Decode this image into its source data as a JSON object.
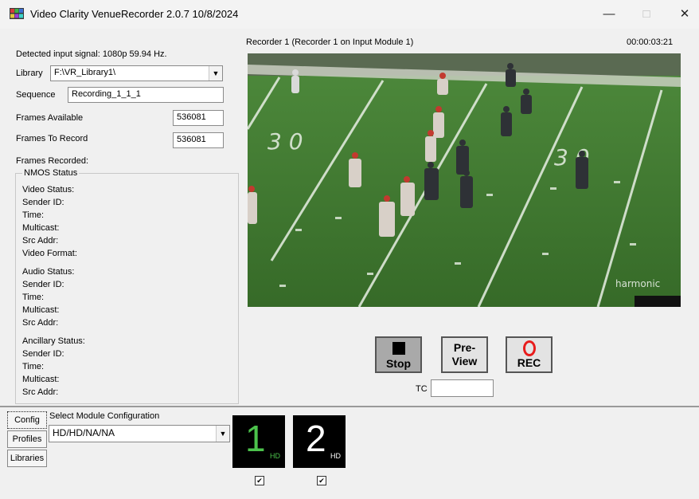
{
  "window": {
    "title": "Video Clarity VenueRecorder  2.0.7  10/8/2024",
    "minimize_glyph": "—",
    "maximize_glyph": "□",
    "close_glyph": "✕"
  },
  "left_panel": {
    "detected_signal": "Detected input signal: 1080p 59.94 Hz.",
    "library_label": "Library",
    "library_value": "F:\\VR_Library1\\",
    "sequence_label": "Sequence",
    "sequence_value": "Recording_1_1_1",
    "frames_available_label": "Frames Available",
    "frames_available_value": "536081",
    "frames_to_record_label": "Frames To Record",
    "frames_to_record_value": "536081",
    "frames_recorded_label": "Frames Recorded:"
  },
  "nmos": {
    "title": "NMOS Status",
    "video_lines": [
      "Video Status:",
      "Sender ID:",
      "Time:",
      "Multicast:",
      "Src Addr:",
      "Video Format:"
    ],
    "audio_lines": [
      "Audio Status:",
      "Sender ID:",
      "Time:",
      "Multicast:",
      "Src Addr:"
    ],
    "ancillary_lines": [
      "Ancillary Status:",
      "Sender ID:",
      "Time:",
      "Multicast:",
      "Src Addr:"
    ]
  },
  "preview": {
    "recorder_label": "Recorder 1 (Recorder 1 on Input Module 1)",
    "timecode": "00:00:03:21",
    "watermark": "harmonic",
    "field_numbers": [
      "3 0",
      "3 0"
    ]
  },
  "controls": {
    "stop_label": "Stop",
    "preview_line1": "Pre-",
    "preview_line2": "View",
    "rec_label": "REC",
    "tc_label": "TC",
    "tc_value": ""
  },
  "bottom": {
    "config_tab": "Config",
    "profiles_tab": "Profiles",
    "libraries_tab": "Libraries",
    "select_label": "Select Module Configuration",
    "module_config_value": "HD/HD/NA/NA",
    "modules": [
      {
        "number": "1",
        "sub": "HD",
        "active": true,
        "checked": true
      },
      {
        "number": "2",
        "sub": "HD",
        "active": false,
        "checked": true
      }
    ]
  },
  "colors": {
    "module_active": "#4cc24c",
    "module_inactive": "#ffffff",
    "rec_red": "#e81c1c",
    "field_green": "#3f7a2f"
  }
}
